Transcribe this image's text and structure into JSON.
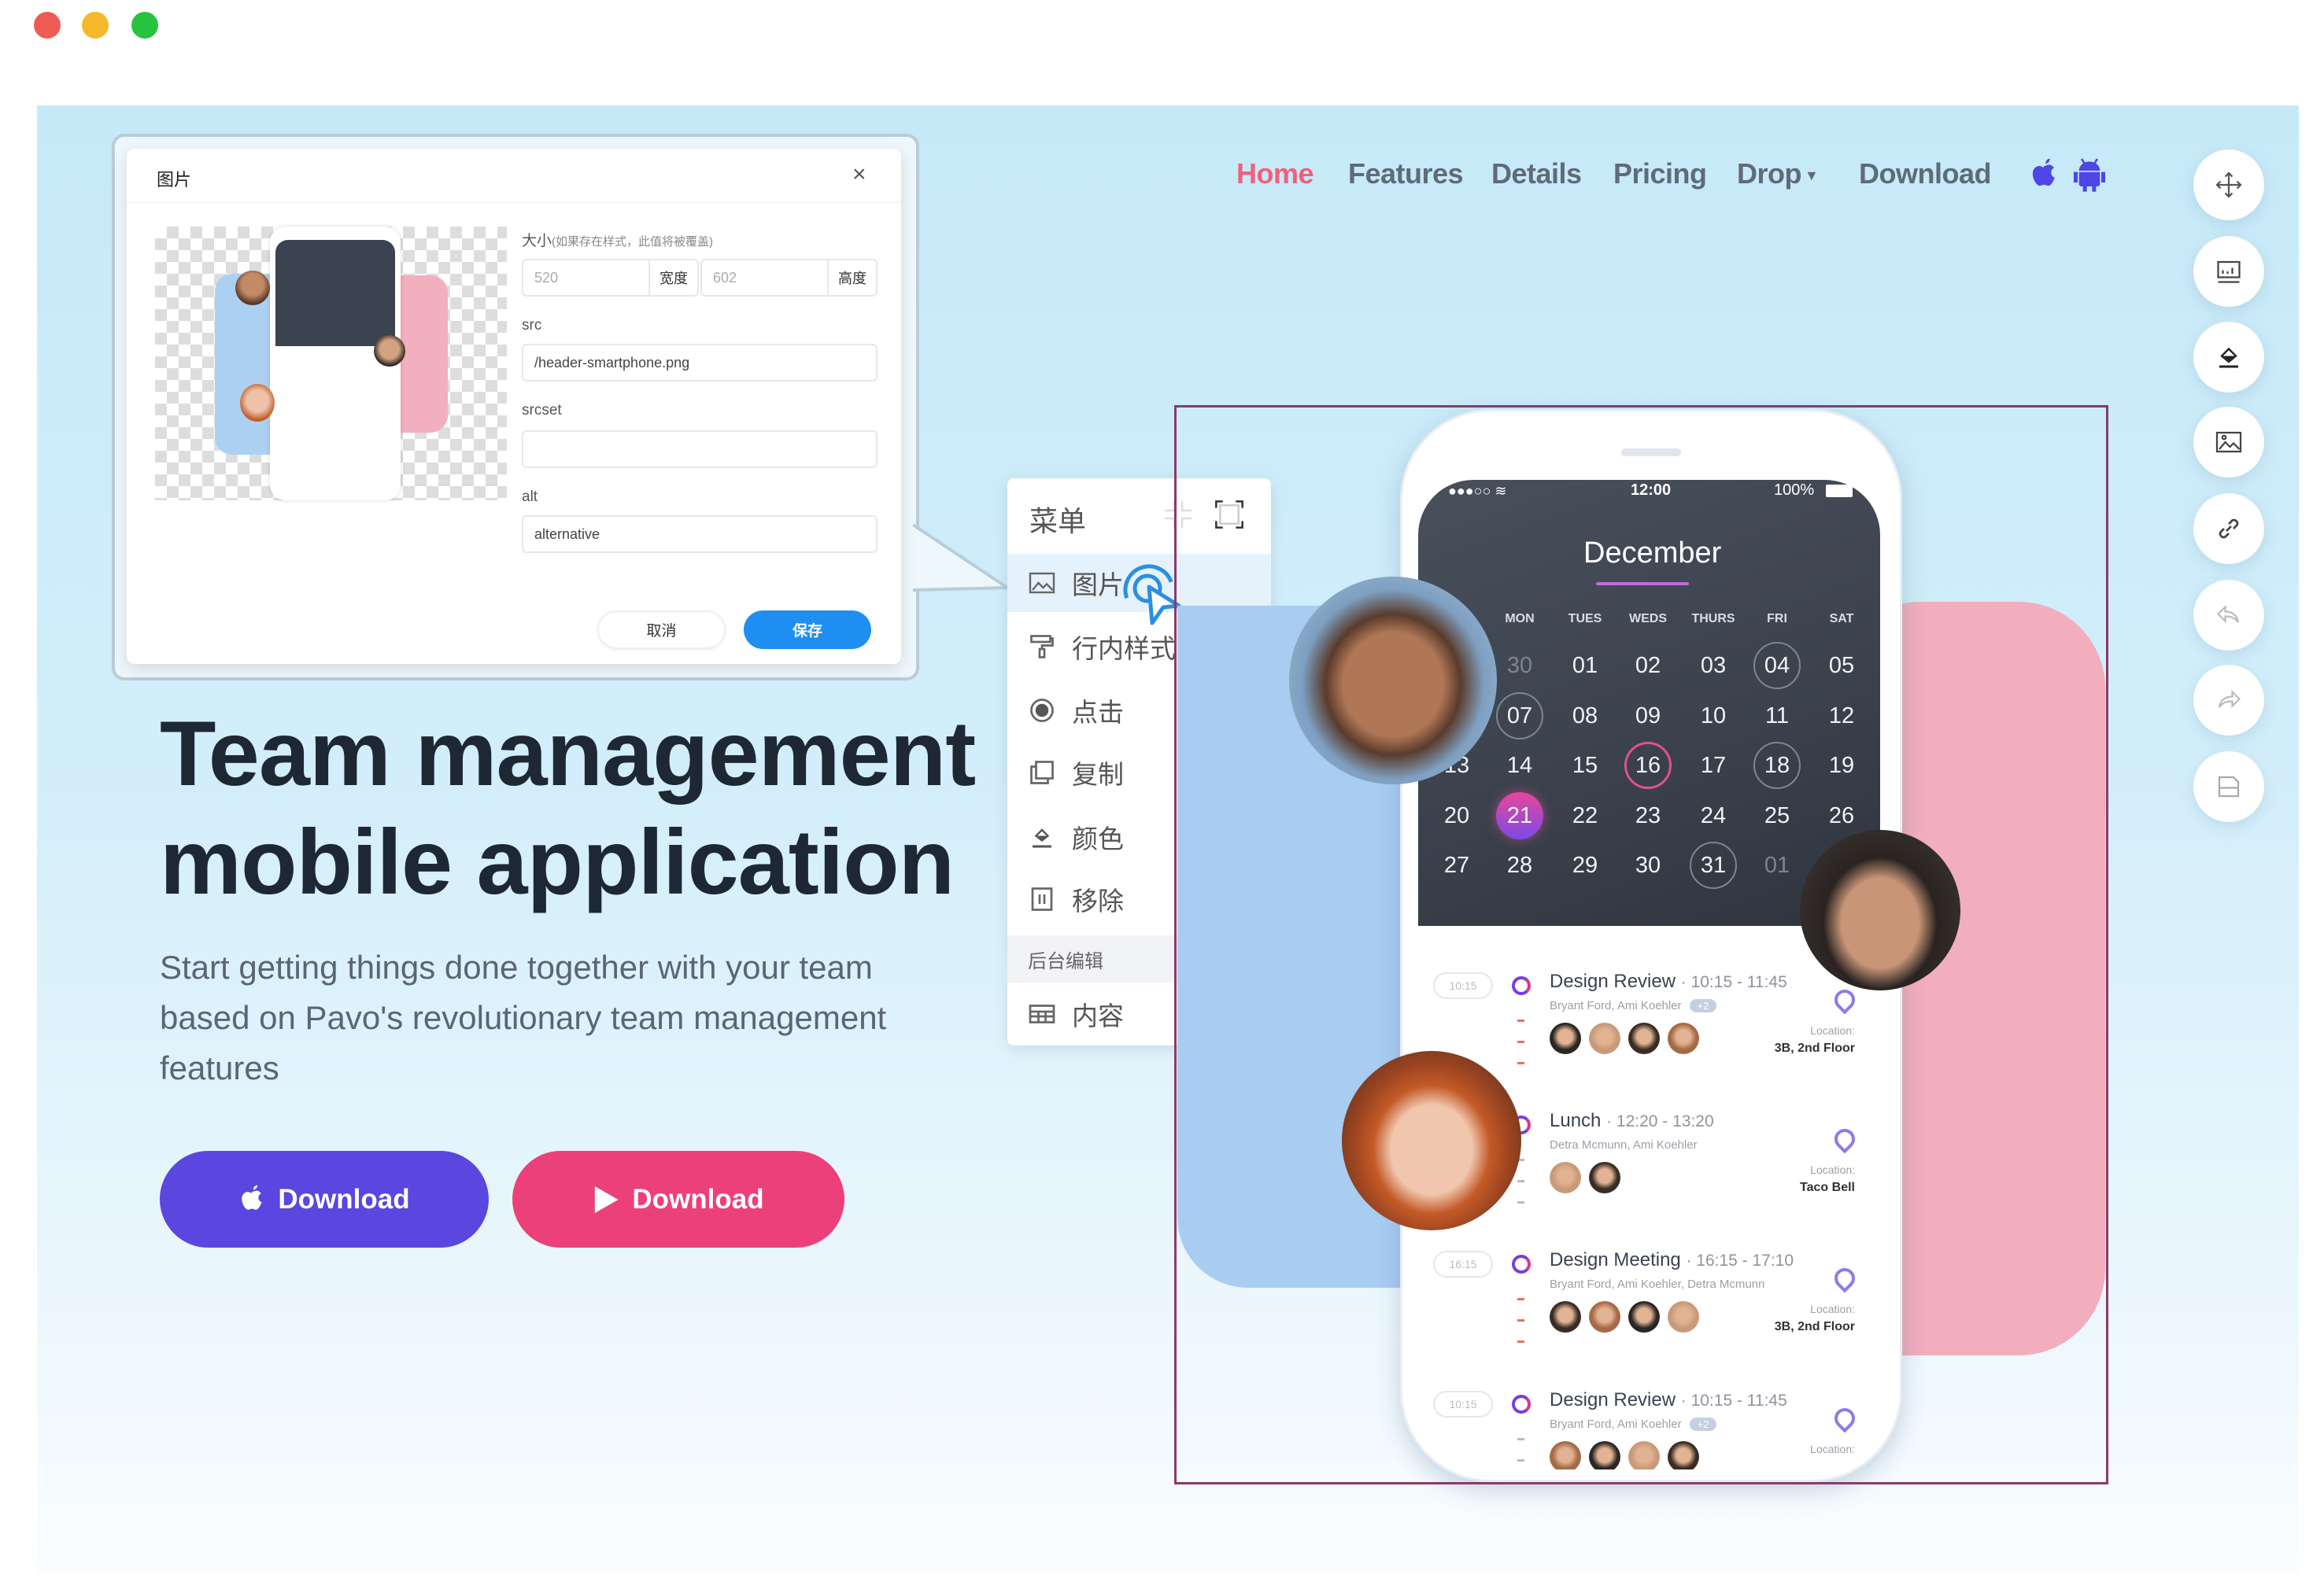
{
  "window": {
    "controls": [
      "close",
      "minimize",
      "maximize"
    ],
    "colors": {
      "close": "#ee5b55",
      "minimize": "#f5b829",
      "maximize": "#27c33f"
    }
  },
  "nav": {
    "items": [
      "Home",
      "Features",
      "Details",
      "Pricing",
      "Drop",
      "Download"
    ],
    "active": "Home",
    "active_color": "#f0607a",
    "icons": [
      "apple-icon",
      "android-icon"
    ],
    "icon_color": "#4f46e5"
  },
  "toolbar": {
    "icons": [
      "move-icon",
      "chart-icon",
      "fill-color-icon",
      "image-icon",
      "link-icon",
      "undo-icon",
      "redo-icon",
      "save-icon"
    ]
  },
  "dialog": {
    "title": "图片",
    "size_label": "大小",
    "size_hint": "(如果存在样式，此值将被覆盖)",
    "width_value": "520",
    "width_unit": "宽度",
    "height_value": "602",
    "height_unit": "高度",
    "src_label": "src",
    "src_value": "/header-smartphone.png",
    "srcset_label": "srcset",
    "srcset_value": "",
    "alt_label": "alt",
    "alt_value": "alternative",
    "cancel": "取消",
    "save": "保存",
    "save_color": "#1e8ff0"
  },
  "menu": {
    "title": "菜单",
    "items": [
      {
        "label": "图片",
        "icon": "image-icon"
      },
      {
        "label": "行内样式",
        "icon": "paint-roller-icon"
      },
      {
        "label": "点击",
        "icon": "radio-icon"
      },
      {
        "label": "复制",
        "icon": "copy-icon"
      },
      {
        "label": "颜色",
        "icon": "fill-color-icon"
      },
      {
        "label": "移除",
        "icon": "trash-icon"
      }
    ],
    "section": "后台编辑",
    "section_items": [
      {
        "label": "内容",
        "icon": "table-icon"
      }
    ]
  },
  "hero": {
    "title_line1": "Team management",
    "title_line2": "mobile application",
    "subtitle": "Start getting things done together with your team based on Pavo's revolutionary team management features",
    "btn_ios": "Download",
    "btn_android": "Download",
    "btn_ios_color": "#5b46e0",
    "btn_android_color": "#ec407a"
  },
  "phone": {
    "status": {
      "time": "12:00",
      "battery": "100%"
    },
    "month": "December",
    "weekdays": [
      "",
      "MON",
      "TUES",
      "WEDS",
      "THURS",
      "FRI",
      "SAT"
    ],
    "weeks": [
      [
        "",
        "30",
        "01",
        "02",
        "03",
        "04",
        "05"
      ],
      [
        "",
        "07",
        "08",
        "09",
        "10",
        "11",
        "12"
      ],
      [
        "13",
        "14",
        "15",
        "16",
        "17",
        "18",
        "19"
      ],
      [
        "20",
        "21",
        "22",
        "23",
        "24",
        "25",
        "26"
      ],
      [
        "27",
        "28",
        "29",
        "30",
        "31",
        "01",
        ""
      ]
    ],
    "outlined": [
      "04",
      "07",
      "18",
      "31"
    ],
    "highlight": "16",
    "selected": "21",
    "muted": [
      "30@0",
      "01@4"
    ],
    "events": [
      {
        "pill": "10:15",
        "title": "Design Review",
        "time": "10:15 - 11:45",
        "people": "Bryant Ford, Ami Koehler",
        "more": "+2",
        "avatars": 4,
        "loc_label": "Location:",
        "location": "3B, 2nd Floor"
      },
      {
        "pill": "",
        "title": "Lunch",
        "time": "12:20 - 13:20",
        "people": "Detra Mcmunn, Ami Koehler",
        "more": "",
        "avatars": 2,
        "loc_label": "Location:",
        "location": "Taco Bell"
      },
      {
        "pill": "16:15",
        "title": "Design Meeting",
        "time": "16:15 - 17:10",
        "people": "Bryant Ford, Ami Koehler, Detra Mcmunn",
        "more": "",
        "avatars": 4,
        "loc_label": "Location:",
        "location": "3B, 2nd Floor"
      },
      {
        "pill": "10:15",
        "title": "Design Review",
        "time": "10:15 - 11:45",
        "people": "Bryant Ford, Ami Koehler",
        "more": "+2",
        "avatars": 4,
        "loc_label": "Location:",
        "location": ""
      }
    ]
  },
  "selection_color": "#8b3a6b"
}
